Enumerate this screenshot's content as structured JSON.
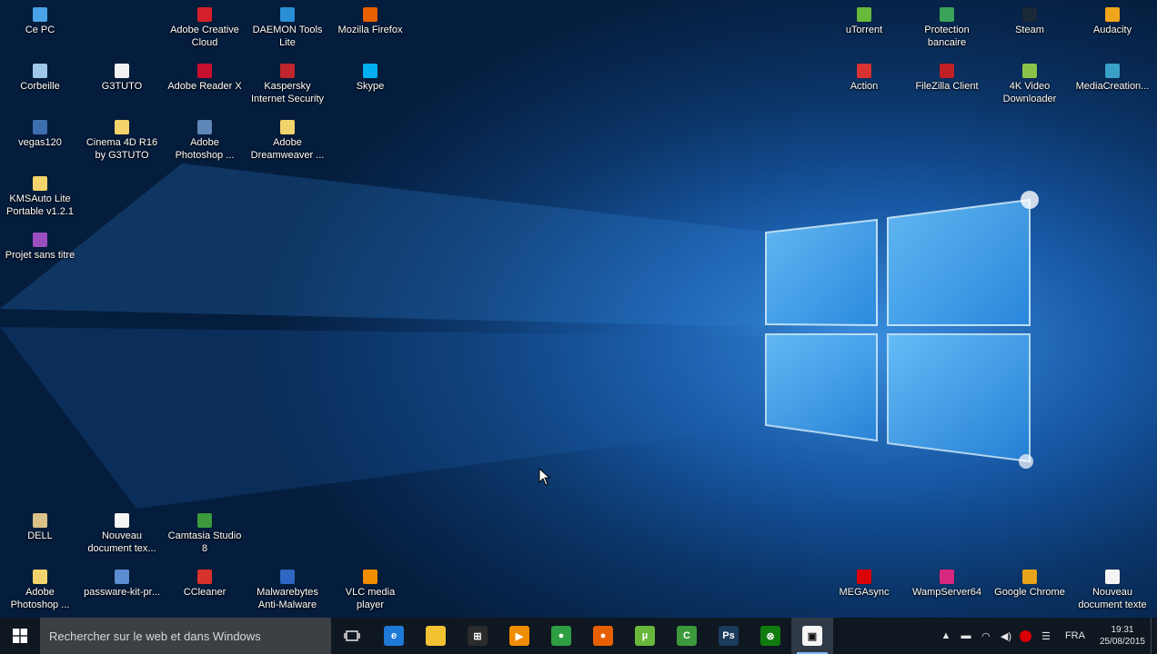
{
  "desktop": {
    "icons_left": [
      {
        "label": "Ce PC",
        "icon": "computer-icon",
        "color": "#4aa3e6"
      },
      {
        "label": "Adobe Creative Cloud",
        "icon": "creative-cloud-icon",
        "color": "#d4202a"
      },
      {
        "label": "DAEMON Tools Lite",
        "icon": "daemon-tools-icon",
        "color": "#2b8fd8"
      },
      {
        "label": "Mozilla Firefox",
        "icon": "firefox-icon",
        "color": "#e66000"
      },
      {
        "label": "Corbeille",
        "icon": "recycle-bin-icon",
        "color": "#9ec8ea"
      },
      {
        "label": "G3TUTO",
        "icon": "document-icon",
        "color": "#f2f2f2"
      },
      {
        "label": "Adobe Reader X",
        "icon": "adobe-reader-icon",
        "color": "#c8102e"
      },
      {
        "label": "Kaspersky Internet Security",
        "icon": "kaspersky-icon",
        "color": "#c0262d"
      },
      {
        "label": "Skype",
        "icon": "skype-icon",
        "color": "#00aff0"
      },
      {
        "label": "vegas120",
        "icon": "vegas-icon",
        "color": "#3d6fb0"
      },
      {
        "label": "Cinema 4D R16 by G3TUTO",
        "icon": "folder-icon",
        "color": "#f3d36b"
      },
      {
        "label": "Adobe Photoshop ...",
        "icon": "shortcut-icon",
        "color": "#5e86b6"
      },
      {
        "label": "Adobe Dreamweaver ...",
        "icon": "folder-icon",
        "color": "#f3d36b"
      },
      {
        "label": "KMSAuto Lite Portable v1.2.1",
        "icon": "folder-icon",
        "color": "#f3d36b"
      },
      {
        "label": "Projet sans titre",
        "icon": "premiere-project-icon",
        "color": "#9a4fc0"
      }
    ],
    "icons_bottom_left": [
      {
        "label": "DELL",
        "icon": "user-folder-icon",
        "color": "#d9c28a"
      },
      {
        "label": "Nouveau document tex...",
        "icon": "text-file-icon",
        "color": "#f5f5f5"
      },
      {
        "label": "Camtasia Studio 8",
        "icon": "camtasia-icon",
        "color": "#3c9a3c"
      },
      {
        "label": "Adobe Photoshop ...",
        "icon": "folder-icon",
        "color": "#f3d36b"
      },
      {
        "label": "passware-kit-pr...",
        "icon": "installer-icon",
        "color": "#5a8ed0"
      },
      {
        "label": "CCleaner",
        "icon": "ccleaner-icon",
        "color": "#d8332a"
      },
      {
        "label": "Malwarebytes Anti-Malware",
        "icon": "malwarebytes-icon",
        "color": "#2d66c3"
      },
      {
        "label": "VLC media player",
        "icon": "vlc-icon",
        "color": "#f08c00"
      }
    ],
    "icons_right": [
      {
        "label": "uTorrent",
        "icon": "utorrent-icon",
        "color": "#68b83c"
      },
      {
        "label": "Protection bancaire",
        "icon": "safe-money-icon",
        "color": "#3aa35a"
      },
      {
        "label": "Steam",
        "icon": "steam-icon",
        "color": "#1b2838"
      },
      {
        "label": "Audacity",
        "icon": "audacity-icon",
        "color": "#f2a51c"
      },
      {
        "label": "Action",
        "icon": "action-icon",
        "color": "#d83333"
      },
      {
        "label": "FileZilla Client",
        "icon": "filezilla-icon",
        "color": "#bf2026"
      },
      {
        "label": "4K Video Downloader",
        "icon": "4k-video-icon",
        "color": "#8bc34a"
      },
      {
        "label": "MediaCreation...",
        "icon": "media-creation-icon",
        "color": "#3aa0c8"
      }
    ],
    "icons_bottom_right": [
      {
        "label": "MEGAsync",
        "icon": "mega-icon",
        "color": "#d90007"
      },
      {
        "label": "WampServer64",
        "icon": "wamp-icon",
        "color": "#d6287d"
      },
      {
        "label": "Google Chrome",
        "icon": "chrome-icon",
        "color": "#e8a31a"
      },
      {
        "label": "Nouveau document texte",
        "icon": "text-file-icon",
        "color": "#f5f5f5"
      }
    ]
  },
  "taskbar": {
    "search_placeholder": "Rechercher sur le web et dans Windows",
    "apps": [
      {
        "name": "edge",
        "icon": "edge-icon",
        "color": "#1e7ad6",
        "glyph": "e"
      },
      {
        "name": "file-explorer",
        "icon": "folder-icon",
        "color": "#f1c232",
        "glyph": ""
      },
      {
        "name": "store",
        "icon": "store-icon",
        "color": "#2b2b2b",
        "glyph": "⊞"
      },
      {
        "name": "media-player",
        "icon": "media-player-icon",
        "color": "#f08c00",
        "glyph": "▶"
      },
      {
        "name": "chrome",
        "icon": "chrome-icon",
        "color": "#2e9e43",
        "glyph": "●"
      },
      {
        "name": "firefox",
        "icon": "firefox-icon",
        "color": "#e66000",
        "glyph": "●"
      },
      {
        "name": "utorrent",
        "icon": "utorrent-icon",
        "color": "#68b83c",
        "glyph": "µ"
      },
      {
        "name": "camtasia",
        "icon": "camtasia-icon",
        "color": "#3c9a3c",
        "glyph": "C"
      },
      {
        "name": "photoshop",
        "icon": "photoshop-icon",
        "color": "#1a3b5c",
        "glyph": "Ps"
      },
      {
        "name": "xbox",
        "icon": "xbox-icon",
        "color": "#107c10",
        "glyph": "⊗"
      },
      {
        "name": "camtasia-recorder",
        "icon": "recorder-icon",
        "color": "#f5f5f5",
        "glyph": "▣"
      }
    ],
    "tray": {
      "language": "FRA",
      "time": "19:31",
      "date": "25/08/2015"
    }
  }
}
